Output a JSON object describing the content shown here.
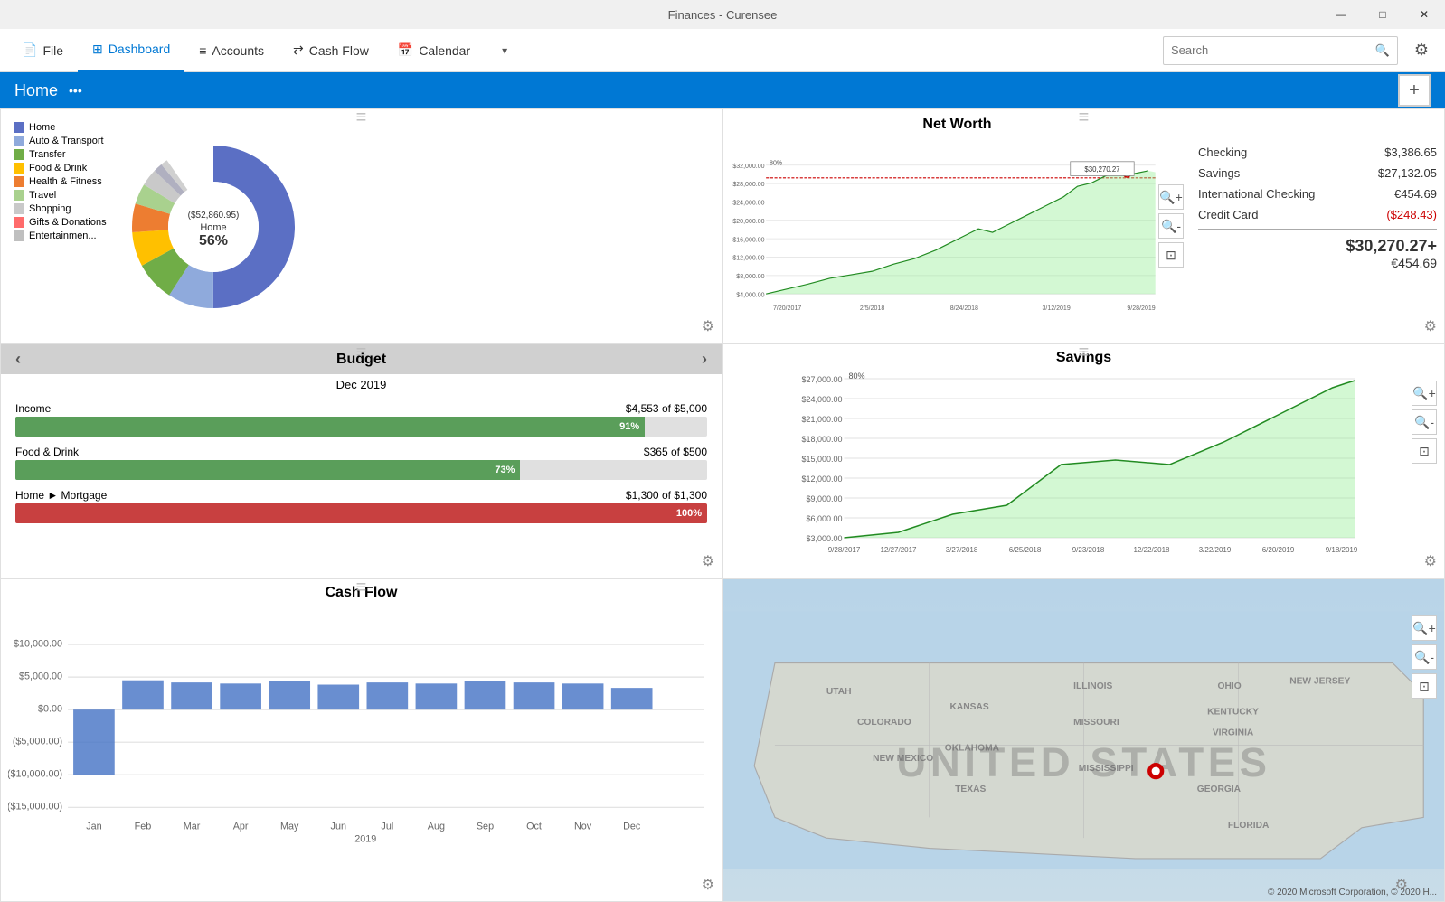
{
  "titleBar": {
    "title": "Finances - Curensee",
    "minimize": "—",
    "maximize": "□",
    "close": "✕"
  },
  "nav": {
    "file": "File",
    "dashboard": "Dashboard",
    "accounts": "Accounts",
    "cashflow": "Cash Flow",
    "calendar": "Calendar",
    "searchPlaceholder": "Search"
  },
  "homeTab": {
    "label": "Home",
    "dots": "•••"
  },
  "spending": {
    "legend": [
      {
        "color": "#5b6fc4",
        "label": "Home"
      },
      {
        "color": "#8faadc",
        "label": "Auto & Transport"
      },
      {
        "color": "#70ad47",
        "label": "Transfer"
      },
      {
        "color": "#ffc000",
        "label": "Food & Drink"
      },
      {
        "color": "#ed7d31",
        "label": "Health & Fitness"
      },
      {
        "color": "#a9d18e",
        "label": "Travel"
      },
      {
        "color": "#c9c9c9",
        "label": "Shopping"
      },
      {
        "color": "#ff0000",
        "label": "Gifts & Donations"
      },
      {
        "color": "#bfbfbf",
        "label": "Entertainmen..."
      }
    ],
    "center_amount": "($52,860.95)",
    "center_label": "Home",
    "center_pct": "56%"
  },
  "networth": {
    "title": "Net Worth",
    "accounts": [
      {
        "name": "Checking",
        "value": "$3,386.65"
      },
      {
        "name": "Savings",
        "value": "$27,132.05"
      },
      {
        "name": "International Checking",
        "value": "€454.69"
      },
      {
        "name": "Credit Card",
        "value": "($248.43)",
        "negative": true
      }
    ],
    "total_usd": "$30,270.27+",
    "total_eur": "€454.69",
    "tooltip_value": "$30,270.27",
    "y_labels": [
      "$32,000.00",
      "$28,000.00",
      "$24,000.00",
      "$20,000.00",
      "$16,000.00",
      "$12,000.00",
      "$8,000.00",
      "$4,000.00"
    ],
    "x_labels": [
      "7/20/2017",
      "2/5/2018",
      "8/24/2018",
      "3/12/2019",
      "9/28/2019"
    ],
    "pct_label": "80%"
  },
  "budget": {
    "title": "Budget",
    "period": "Dec 2019",
    "rows": [
      {
        "label": "Income",
        "value": "$4,553 of $5,000",
        "pct": 91,
        "color": "green"
      },
      {
        "label": "Food & Drink",
        "value": "$365 of $500",
        "pct": 73,
        "color": "green"
      },
      {
        "label": "Home ► Mortgage",
        "value": "$1,300 of $1,300",
        "pct": 100,
        "color": "red"
      }
    ]
  },
  "savings": {
    "title": "Savings",
    "y_labels": [
      "$27,000.00",
      "$24,000.00",
      "$21,000.00",
      "$18,000.00",
      "$15,000.00",
      "$12,000.00",
      "$9,000.00",
      "$6,000.00",
      "$3,000.00"
    ],
    "x_labels": [
      "9/28/2017",
      "12/27/2017",
      "3/27/2018",
      "6/25/2018",
      "9/23/2018",
      "12/22/2018",
      "3/22/2019",
      "6/20/2019",
      "9/18/2019"
    ],
    "pct_label": "80%"
  },
  "cashflow": {
    "title": "Cash Flow",
    "y_labels": [
      "$10,000.00",
      "$5,000.00",
      "$0.00",
      "($5,000.00)",
      "($10,000.00)",
      "($15,000.00)"
    ],
    "x_labels": [
      "Jan",
      "Feb",
      "Mar",
      "Apr",
      "May",
      "Jun",
      "Jul",
      "Aug",
      "Sep",
      "Oct",
      "Nov",
      "Dec"
    ],
    "year": "2019"
  },
  "map": {
    "overlay_text": "UNITED STATES",
    "copyright": "© 2020 Microsoft Corporation, © 2020 H..."
  }
}
